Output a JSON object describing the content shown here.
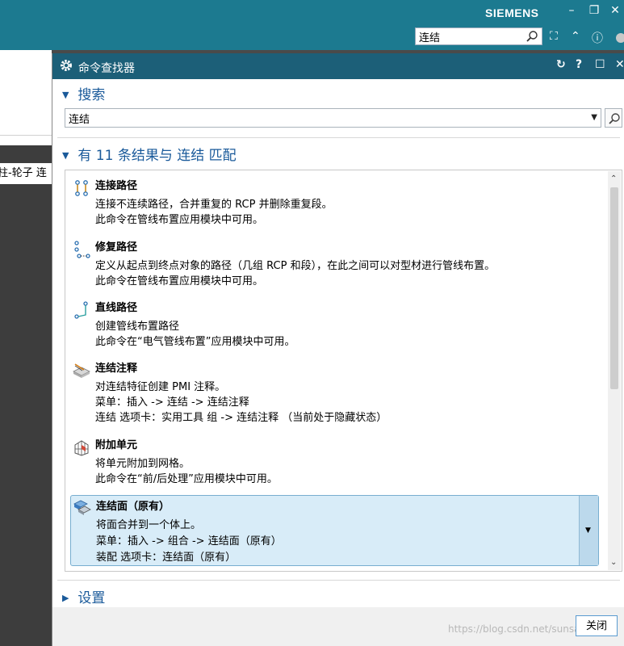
{
  "app": {
    "brand": "SIEMENS",
    "search_value": "连结"
  },
  "dialog": {
    "title": "命令查找器",
    "search_section": "搜索",
    "search_value": "连结",
    "results_header": "有 11 条结果与 连结 匹配",
    "settings_section": "设置",
    "close_label": "关闭"
  },
  "background": {
    "tab_text": "柱-轮子 连"
  },
  "results": [
    {
      "name": "连接路径",
      "icon": "join-path-icon",
      "lines": [
        "连接不连续路径，合并重复的 RCP 并删除重复段。",
        "此命令在管线布置应用模块中可用。"
      ]
    },
    {
      "name": "修复路径",
      "icon": "repair-path-icon",
      "lines": [
        "定义从起点到终点对象的路径（几组 RCP 和段），在此之间可以对型材进行管线布置。",
        "此命令在管线布置应用模块中可用。"
      ]
    },
    {
      "name": "直线路径",
      "icon": "linear-path-icon",
      "lines": [
        "创建管线布置路径",
        "此命令在“电气管线布置”应用模块中可用。"
      ]
    },
    {
      "name": "连结注释",
      "icon": "connection-note-icon",
      "lines": [
        "对连结特征创建 PMI 注释。",
        "菜单：插入 -> 连结 -> 连结注释",
        "连结 选项卡：实用工具 组 -> 连结注释  （当前处于隐藏状态）"
      ]
    },
    {
      "name": "附加单元",
      "icon": "attach-element-icon",
      "lines": [
        "将单元附加到网格。",
        "此命令在“前/后处理”应用模块中可用。"
      ]
    },
    {
      "name": "连结面（原有）",
      "icon": "unite-faces-icon",
      "lines": [
        "将面合并到一个体上。",
        "菜单：插入 -> 组合 -> 连结面（原有）",
        "装配 选项卡：连结面（原有）"
      ]
    }
  ],
  "watermark": "https://blog.csdn.net/sunsa..."
}
